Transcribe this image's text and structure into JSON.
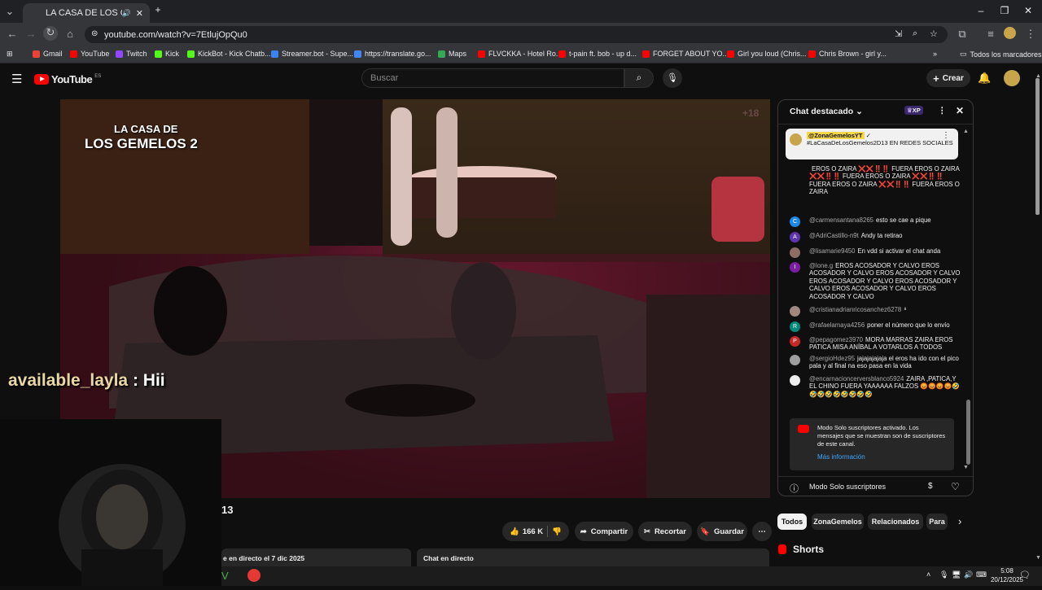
{
  "browser": {
    "tab_title": "LA CASA DE LOS GEMELOS",
    "url": "youtube.com/watch?v=7EtlujOpQu0",
    "bookmarks": [
      {
        "label": "Gmail",
        "color": "#ea4335"
      },
      {
        "label": "YouTube",
        "color": "#ff0000"
      },
      {
        "label": "Twitch",
        "color": "#9146ff"
      },
      {
        "label": "Kick",
        "color": "#53fc18"
      },
      {
        "label": "KickBot - Kick Chatb...",
        "color": "#53fc18"
      },
      {
        "label": "Streamer.bot - Supe...",
        "color": "#3b82f6"
      },
      {
        "label": "https://translate.go...",
        "color": "#4285f4"
      },
      {
        "label": "Maps",
        "color": "#34a853"
      },
      {
        "label": "FLVCKKA - Hotel Ro...",
        "color": "#ff0000"
      },
      {
        "label": "t-pain ft. bob - up d...",
        "color": "#ff0000"
      },
      {
        "label": "FORGET ABOUT YO...",
        "color": "#ff0000"
      },
      {
        "label": "Girl you loud (Chris...",
        "color": "#ff0000"
      },
      {
        "label": "Chris Brown - girl y...",
        "color": "#ff0000"
      }
    ],
    "all_bookmarks": "Todos los marcadores"
  },
  "youtube": {
    "logo": "YouTube",
    "region": "ES",
    "search_placeholder": "Buscar",
    "create_label": "Crear"
  },
  "video": {
    "show_logo_line1": "LA CASA DE",
    "show_logo_line2": "LOS GEMELOS 2",
    "age_badge": "+18",
    "overlay_user": "available_layla",
    "overlay_text": ": Hii",
    "title_fragment": "13",
    "likes": "166 K",
    "share": "Compartir",
    "clip": "Recortar",
    "save": "Guardar",
    "live_date": "e en directo el 7 dic 2025",
    "live_chat": "Chat en directo"
  },
  "chat": {
    "title": "Chat destacado",
    "xp": "XP",
    "pinned_author": "@ZonaGemelosYT",
    "pinned_text": "#LaCasaDeLosGemelos2D13 EN REDES SOCIALES",
    "messages": [
      {
        "author": "",
        "text": "EROS O ZAIRA ❌❌‼️‼️ FUERA EROS O ZAIRA ❌❌‼️‼️ FUERA EROS O ZAIRA ❌❌‼️‼️ FUERA EROS O ZAIRA ❌❌‼️‼️ FUERA EROS O ZAIRA",
        "initial": "",
        "color": "transparent"
      },
      {
        "author": "@carmensantana8265",
        "text": "esto se cae a pique",
        "initial": "C",
        "color": "#1e88e5"
      },
      {
        "author": "@AdriCastillo-n9t",
        "text": "Andy ta retirao",
        "initial": "A",
        "color": "#5e35b1"
      },
      {
        "author": "@lisamarie9450",
        "text": "En vdd si activar el chat anda",
        "initial": "",
        "color": "#8d6e63"
      },
      {
        "author": "@lone.g",
        "text": "EROS ACOSADOR Y CALVO EROS ACOSADOR Y CALVO EROS ACOSADOR Y CALVO EROS ACOSADOR Y CALVO EROS ACOSADOR Y CALVO EROS ACOSADOR Y CALVO EROS ACOSADOR Y CALVO",
        "initial": "I",
        "color": "#7b1fa2"
      },
      {
        "author": "@cristianadrianricosanchez6278",
        "text": "⁸",
        "initial": "",
        "color": "#a1887f"
      },
      {
        "author": "@rafaelamaya4256",
        "text": "poner el número que lo envío",
        "initial": "R",
        "color": "#00897b"
      },
      {
        "author": "@pepagomez3970",
        "text": "MORA MARRAS ZAIRA EROS PATICA MISA ANÍBAL A VOTARLOS A TODOS",
        "initial": "P",
        "color": "#c62828"
      },
      {
        "author": "@sergioHdez95",
        "text": "jajajajajaja el eros ha ido con el pico pala y al final na eso pasa en la vida",
        "initial": "",
        "color": "#9e9e9e"
      },
      {
        "author": "@encarnacioncerversblanco5924",
        "text": "ZAIRA ,PATICA,Y EL CHINO FUERA YAAAAAA FALZOS 😡😡😡😡🤣🤣🤣🤣🤣🤣🤣🤣🤣",
        "initial": "",
        "color": "#eeeeee"
      }
    ],
    "members_notice": "Modo Solo suscriptores activado. Los mensajes que se muestran son de suscriptores de este canal.",
    "more_info": "Más información",
    "footer_mode": "Modo Solo suscriptores"
  },
  "recommend_chips": [
    "Todos",
    "ZonaGemelos",
    "Relacionados",
    "Para"
  ],
  "shorts_label": "Shorts",
  "clock": {
    "time": "5:08",
    "date": "20/12/2025"
  }
}
